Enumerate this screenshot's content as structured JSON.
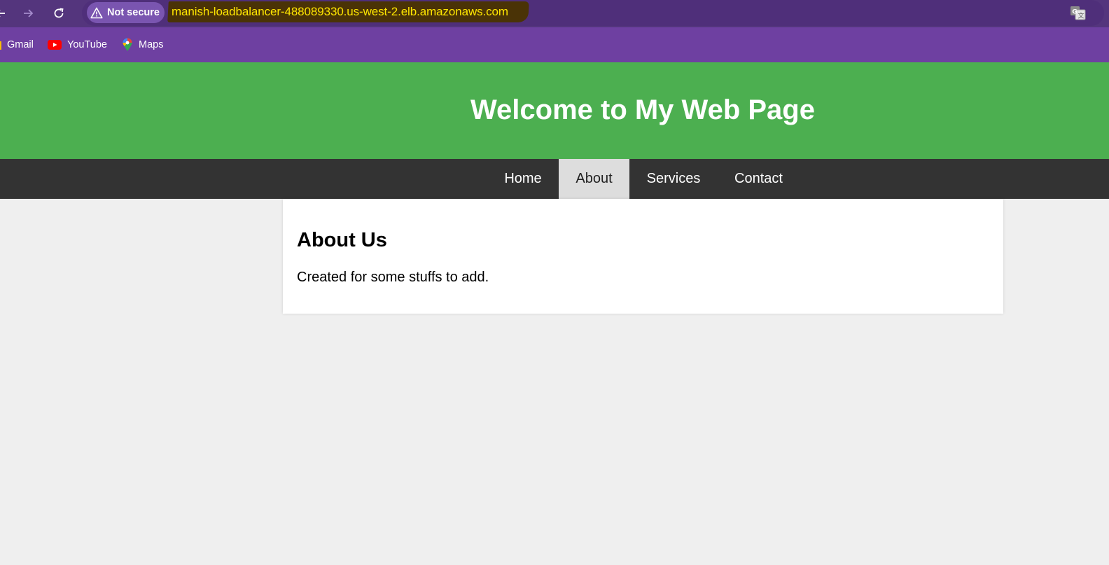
{
  "browser": {
    "security_label": "Not secure",
    "url": "manish-loadbalancer-488089330.us-west-2.elb.amazonaws.com",
    "bookmarks": [
      {
        "label": "Gmail",
        "icon": "gmail-icon"
      },
      {
        "label": "YouTube",
        "icon": "youtube-icon"
      },
      {
        "label": "Maps",
        "icon": "maps-icon"
      }
    ]
  },
  "page": {
    "title": "Welcome to My Web Page",
    "nav": [
      {
        "label": "Home",
        "active": false
      },
      {
        "label": "About",
        "active": true
      },
      {
        "label": "Services",
        "active": false
      },
      {
        "label": "Contact",
        "active": false
      }
    ],
    "section": {
      "heading": "About Us",
      "body": "Created for some stuffs to add."
    }
  },
  "colors": {
    "toolbar": "#54357d",
    "bookmarks_bar": "#6e40a1",
    "header": "#4caf50",
    "nav": "#333333",
    "nav_active": "#dddddd",
    "url_text": "#ffe600"
  }
}
